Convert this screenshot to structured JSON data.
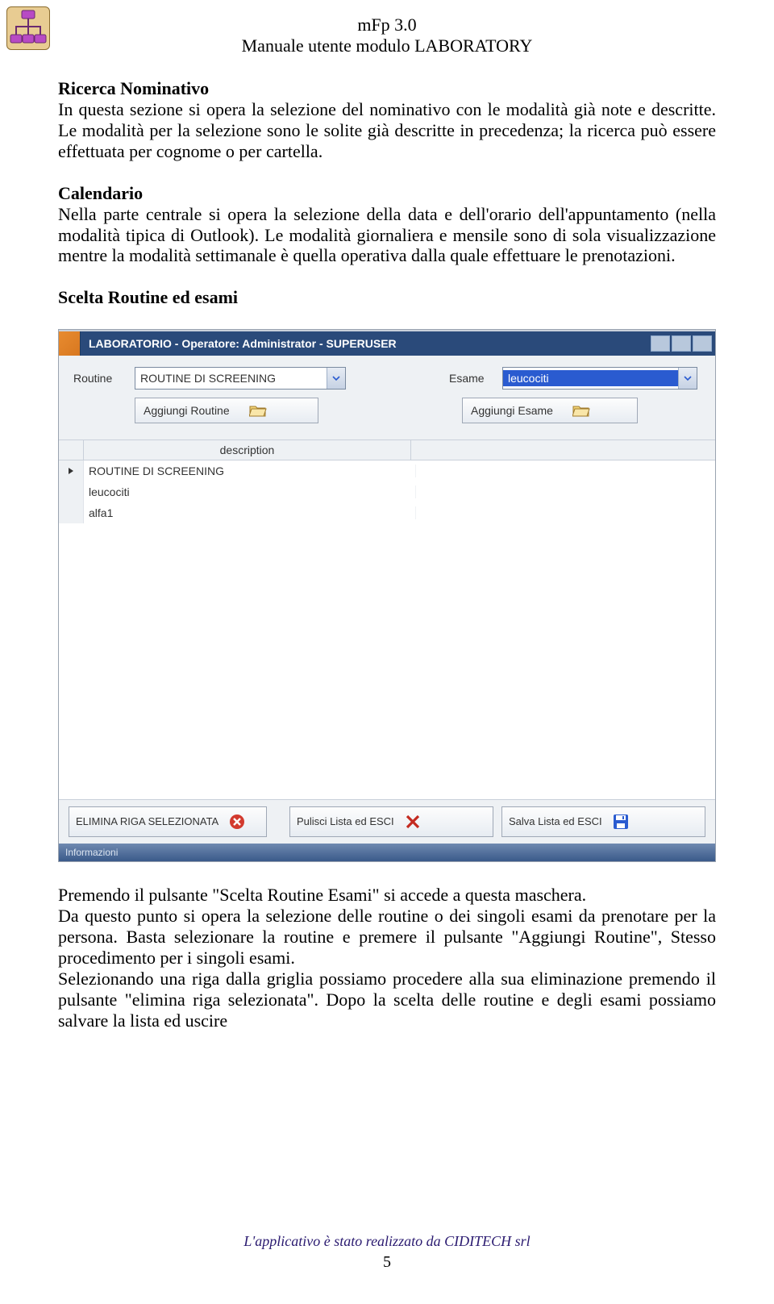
{
  "header": {
    "line1": "mFp 3.0",
    "line2": "Manuale utente modulo LABORATORY"
  },
  "s1": {
    "title": "Ricerca Nominativo",
    "text": "In questa sezione si opera la selezione del nominativo con le modalità già note e descritte. Le modalità per la selezione sono le solite già descritte in precedenza; la ricerca può essere effettuata per cognome o per cartella."
  },
  "s2": {
    "title": "Calendario",
    "text": "Nella parte centrale si opera la selezione della data e dell'orario dell'appuntamento (nella modalità tipica di Outlook). Le modalità giornaliera e mensile sono di sola visualizzazione mentre la modalità settimanale è quella operativa dalla quale effettuare le prenotazioni."
  },
  "s3": {
    "title": "Scelta Routine ed esami"
  },
  "ui": {
    "titlebar": "LABORATORIO - Operatore: Administrator -  SUPERUSER",
    "routine_lbl": "Routine",
    "routine_val": "ROUTINE DI SCREENING",
    "add_routine": "Aggiungi Routine",
    "esame_lbl": "Esame",
    "esame_val": "leucociti",
    "add_esame": "Aggiungi Esame",
    "col_desc": "description",
    "rows": [
      "ROUTINE DI SCREENING",
      "leucociti",
      "alfa1"
    ],
    "btn_elimina": "ELIMINA RIGA SELEZIONATA",
    "btn_pulisci": "Pulisci Lista ed ESCI",
    "btn_salva": "Salva Lista ed ESCI",
    "status": "Informazioni"
  },
  "after": {
    "p1": "Premendo il pulsante \"Scelta Routine Esami\" si accede a questa maschera.",
    "p2": "Da questo punto si opera la selezione delle routine o dei singoli esami da prenotare per la persona. Basta selezionare la routine e premere il pulsante \"Aggiungi Routine\", Stesso procedimento per i singoli esami.",
    "p3": "Selezionando una riga dalla griglia possiamo procedere alla sua eliminazione premendo il pulsante \"elimina riga selezionata\". Dopo la scelta delle routine e degli esami possiamo salvare la lista ed uscire"
  },
  "footer": "L'applicativo è stato realizzato da CIDITECH srl",
  "pagenum": "5"
}
